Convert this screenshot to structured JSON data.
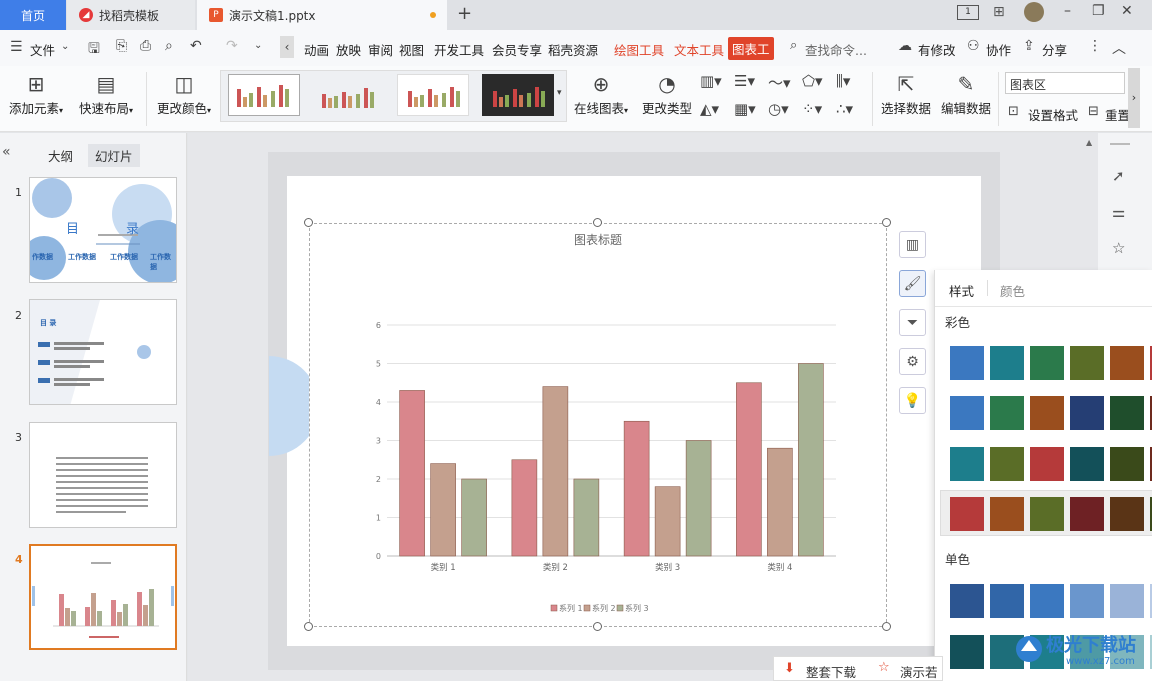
{
  "tabs": {
    "home": "首页",
    "template": "找稻壳模板",
    "doc": "演示文稿1.pptx",
    "new_tab": "+"
  },
  "window": {
    "layout_icon": "1",
    "minimize": "–",
    "restore": "❐",
    "close": "✕"
  },
  "menu": {
    "file": "文件",
    "items": [
      "动画",
      "放映",
      "审阅",
      "视图",
      "开发工具",
      "会员专享",
      "稻壳资源"
    ],
    "draw_tools": "绘图工具",
    "text_tools": "文本工具",
    "chart_tools": "图表工",
    "search": "查找命令...",
    "has_changes": "有修改",
    "collaborate": "协作",
    "share": "分享"
  },
  "ribbon": {
    "add_element": "添加元素",
    "quick_layout": "快速布局",
    "change_color": "更改颜色",
    "online_chart": "在线图表",
    "change_type": "更改类型",
    "select_data": "选择数据",
    "edit_data": "编辑数据",
    "chart_area": "图表区",
    "set_format": "设置格式",
    "reset": "重置"
  },
  "left_panel": {
    "outline": "大纲",
    "slides": "幻灯片",
    "slide_numbers": [
      "1",
      "2",
      "3",
      "4"
    ],
    "slide1_title_a": "目",
    "slide1_title_b": "录",
    "slide1_items": [
      "作数据",
      "工作数据",
      "工作数据",
      "工作数据"
    ],
    "slide2_title": "目 录"
  },
  "slide_chart": {
    "title": "图表标题"
  },
  "chart_data": {
    "type": "bar",
    "title": "图表标题",
    "categories": [
      "类别 1",
      "类别 2",
      "类别 3",
      "类别 4"
    ],
    "series": [
      {
        "name": "系列 1",
        "values": [
          4.3,
          2.5,
          3.5,
          4.5
        ],
        "color": "#d9868c"
      },
      {
        "name": "系列 2",
        "values": [
          2.4,
          4.4,
          1.8,
          2.8
        ],
        "color": "#c4a08e"
      },
      {
        "name": "系列 3",
        "values": [
          2.0,
          2.0,
          3.0,
          5.0
        ],
        "color": "#a7b294"
      }
    ],
    "ylim": [
      0,
      6
    ],
    "yticks": [
      "0",
      "1",
      "2",
      "3",
      "4",
      "5",
      "6"
    ],
    "grid": true,
    "legend": "bottom"
  },
  "style_panel": {
    "tab_style": "样式",
    "tab_color": "颜色",
    "section_colorful": "彩色",
    "section_mono": "单色"
  },
  "colors": {
    "accent": "#3f7ee8",
    "red_tab": "#e0442a",
    "selected_row": "#eeeeee"
  },
  "bottom": {
    "download": "整套下载",
    "present": "演示若"
  },
  "watermark": {
    "text": "极光下载站",
    "url": "www.xz7.com"
  }
}
